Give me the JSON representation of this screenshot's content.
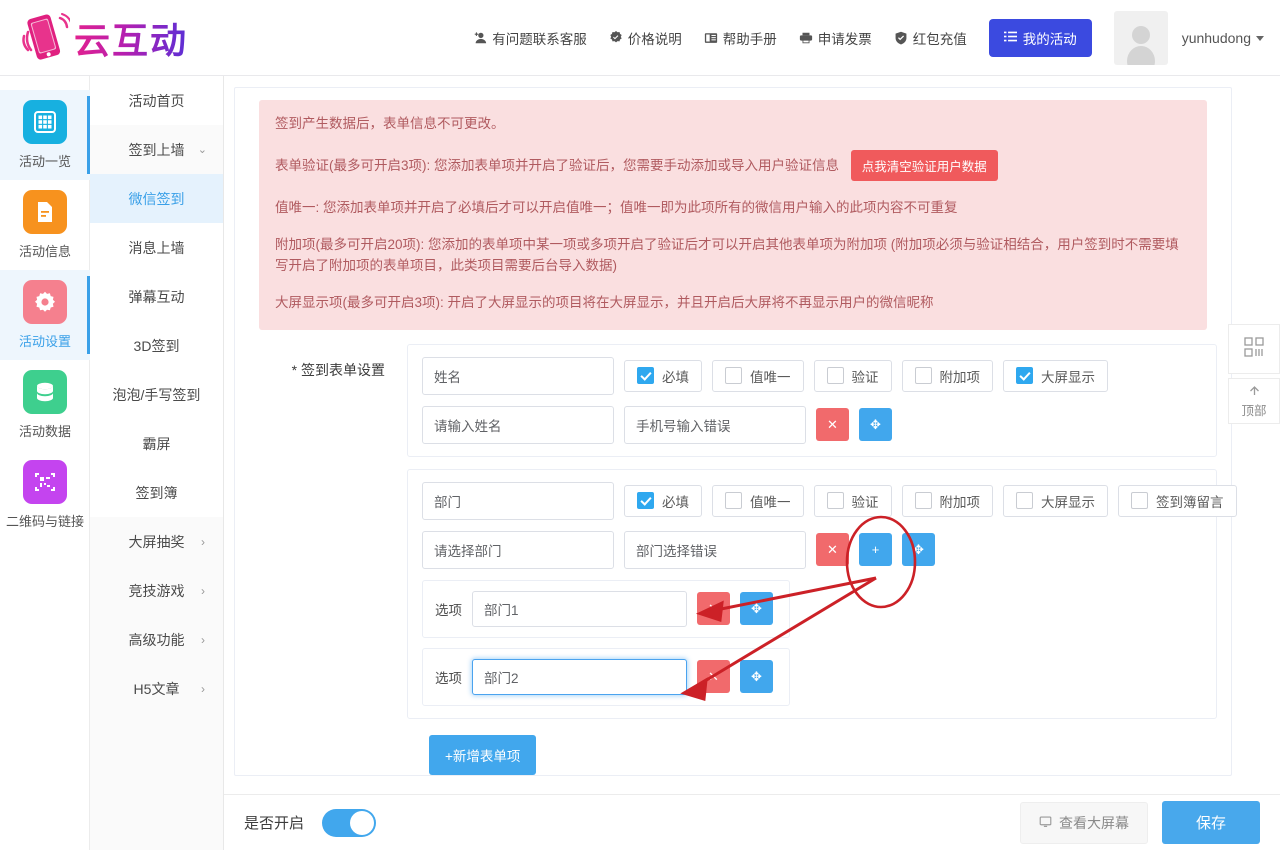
{
  "header": {
    "brand": "云互动",
    "nav": [
      {
        "icon": "user-plus-icon",
        "label": "有问题联系客服"
      },
      {
        "icon": "badge-check-icon",
        "label": "价格说明"
      },
      {
        "icon": "book-icon",
        "label": "帮助手册"
      },
      {
        "icon": "printer-icon",
        "label": "申请发票"
      },
      {
        "icon": "shield-icon",
        "label": "红包充值"
      }
    ],
    "my_activity_button": "我的活动",
    "username": "yunhudong"
  },
  "rail": {
    "items": [
      {
        "label": "活动一览",
        "icon": "grid-icon",
        "color": "#17b0e0",
        "active": false
      },
      {
        "label": "活动信息",
        "icon": "document-icon",
        "color": "#f7921e",
        "active": false
      },
      {
        "label": "活动设置",
        "icon": "gear-icon",
        "color": "#f5808e",
        "active": true
      },
      {
        "label": "活动数据",
        "icon": "database-icon",
        "color": "#3ecf8e",
        "active": false
      },
      {
        "label": "二维码与链接",
        "icon": "qrcode-icon",
        "color": "#c444ef",
        "active": false
      }
    ]
  },
  "submenu": {
    "items": [
      {
        "label": "活动首页",
        "type": "item",
        "active": false
      },
      {
        "label": "签到上墙",
        "type": "group-open",
        "active": false
      },
      {
        "label": "微信签到",
        "type": "sub",
        "active": true
      },
      {
        "label": "消息上墙",
        "type": "sub",
        "active": false
      },
      {
        "label": "弹幕互动",
        "type": "sub",
        "active": false
      },
      {
        "label": "3D签到",
        "type": "sub",
        "active": false
      },
      {
        "label": "泡泡/手写签到",
        "type": "sub",
        "active": false
      },
      {
        "label": "霸屏",
        "type": "sub",
        "active": false
      },
      {
        "label": "签到簿",
        "type": "sub",
        "active": false
      },
      {
        "label": "大屏抽奖",
        "type": "group",
        "active": false
      },
      {
        "label": "竞技游戏",
        "type": "group",
        "active": false
      },
      {
        "label": "高级功能",
        "type": "group",
        "active": false
      },
      {
        "label": "H5文章",
        "type": "group",
        "active": false
      }
    ]
  },
  "notice": {
    "line1": "签到产生数据后，表单信息不可更改。",
    "line2_prefix": "表单验证(最多可开启3项): 您添加表单项并开启了验证后，您需要手动添加或导入用户验证信息",
    "clear_button": "点我清空验证用户数据",
    "line3": "值唯一: 您添加表单项并开启了必填后才可以开启值唯一；值唯一即为此项所有的微信用户输入的此项内容不可重复",
    "line4": "附加项(最多可开启20项): 您添加的表单项中某一项或多项开启了验证后才可以开启其他表单项为附加项 (附加项必须与验证相结合，用户签到时不需要填写开启了附加项的表单项目，此类项目需要后台导入数据)",
    "line5": "大屏显示项(最多可开启3项): 开启了大屏显示的项目将在大屏显示，并且开启后大屏将不再显示用户的微信昵称"
  },
  "form": {
    "section_label": "* 签到表单设置",
    "add_item_button": "+新增表单项",
    "items": [
      {
        "name": "姓名",
        "placeholder": "请输入姓名",
        "error_text": "手机号输入错误",
        "checkboxes": [
          {
            "label": "必填",
            "checked": true
          },
          {
            "label": "值唯一",
            "checked": false
          },
          {
            "label": "验证",
            "checked": false
          },
          {
            "label": "附加项",
            "checked": false
          },
          {
            "label": "大屏显示",
            "checked": true
          }
        ],
        "buttons": [
          {
            "name": "delete-button",
            "glyph": "✕",
            "color": "red"
          },
          {
            "name": "move-button",
            "glyph": "✥",
            "color": "blue"
          }
        ],
        "options": []
      },
      {
        "name": "部门",
        "placeholder": "请选择部门",
        "error_text": "部门选择错误",
        "checkboxes": [
          {
            "label": "必填",
            "checked": true
          },
          {
            "label": "值唯一",
            "checked": false
          },
          {
            "label": "验证",
            "checked": false
          },
          {
            "label": "附加项",
            "checked": false
          },
          {
            "label": "大屏显示",
            "checked": false
          },
          {
            "label": "签到簿留言",
            "checked": false
          }
        ],
        "buttons": [
          {
            "name": "delete-button",
            "glyph": "✕",
            "color": "red"
          },
          {
            "name": "add-option-button",
            "glyph": "+",
            "color": "blue"
          },
          {
            "name": "move-button",
            "glyph": "✥",
            "color": "blue"
          }
        ],
        "option_label": "选项",
        "options": [
          {
            "value": "部门1",
            "focused": false
          },
          {
            "value": "部门2",
            "focused": true
          }
        ]
      }
    ]
  },
  "footer": {
    "enable_label": "是否开启",
    "enabled": true,
    "view_screen_button": "查看大屏幕",
    "save_button": "保存"
  },
  "float_widget": {
    "qr_label": "",
    "top_label": "顶部"
  },
  "colors": {
    "primary_blue": "#41a7ed",
    "brand_blue": "#3b4ae0",
    "danger_red": "#f16a6c",
    "notice_bg": "#fadfe0",
    "notice_text": "#b05a5f",
    "annotation_red": "#cc2127"
  }
}
